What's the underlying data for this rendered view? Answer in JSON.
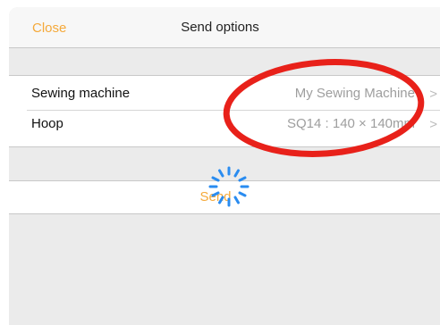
{
  "navbar": {
    "close_label": "Close",
    "title": "Send options"
  },
  "settings": {
    "rows": [
      {
        "label": "Sewing machine",
        "value": "My Sewing Machine",
        "chevron": ">"
      },
      {
        "label": "Hoop",
        "value": "SQ14 : 140 × 140mm",
        "chevron": ">"
      }
    ]
  },
  "send": {
    "label": "Send"
  },
  "colors": {
    "accent": "#f5a93a",
    "highlight_circle": "#e8211a",
    "spinner": "#2a8cf0"
  }
}
